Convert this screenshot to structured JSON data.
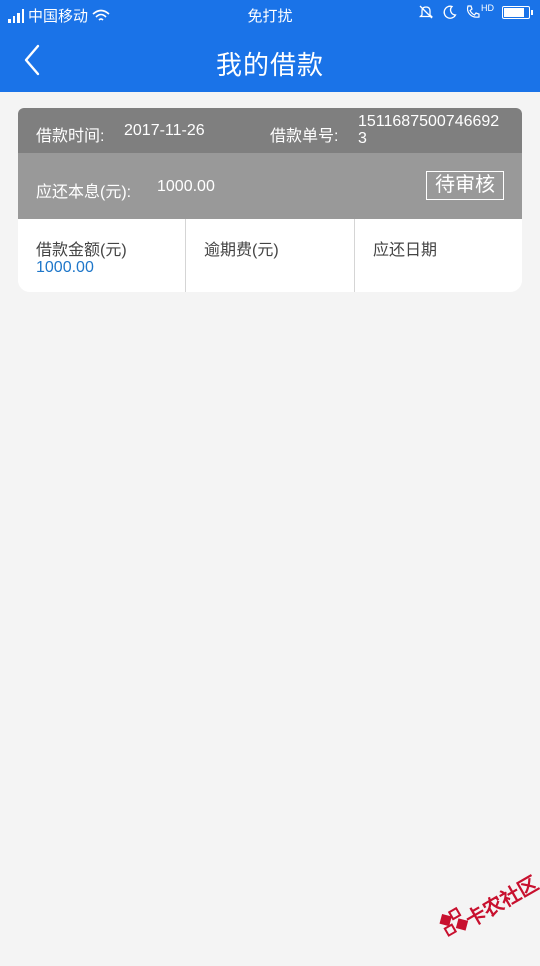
{
  "statusbar": {
    "carrier": "中国移动",
    "mode": "免打扰",
    "network_badge": "HD",
    "battery_level": 0.85,
    "icons": [
      "signal-icon",
      "wifi-icon",
      "bell-off-icon",
      "moon-icon",
      "phone-hd-icon",
      "battery-icon"
    ]
  },
  "header": {
    "title": "我的借款",
    "back_icon": "chevron-left-icon"
  },
  "loan": {
    "time_label": "借款时间:",
    "time_value": "2017-11-26",
    "order_label": "借款单号:",
    "order_value": "15116875007466923",
    "due_label": "应还本息(元):",
    "due_value": "1000.00",
    "status": "待审核",
    "columns": [
      {
        "label": "借款金额(元)",
        "value": "1000.00"
      },
      {
        "label": "逾期费(元)",
        "value": ""
      },
      {
        "label": "应还日期",
        "value": ""
      }
    ]
  },
  "colors": {
    "primary": "#1a73e8",
    "card_top": "#7f7f7f",
    "card_mid": "#999999",
    "value_blue": "#1f77c9",
    "watermark_red": "#c8102e"
  },
  "watermark": {
    "text": "卡农社区"
  }
}
